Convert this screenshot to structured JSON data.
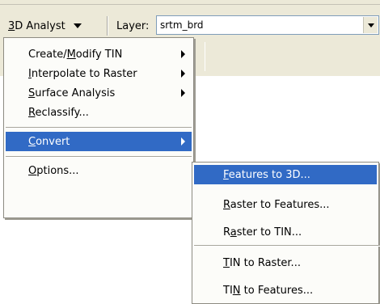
{
  "toolbar": {
    "menu_label_u": "3",
    "menu_label_rest": "D Analyst",
    "layer_label": "Layer:",
    "layer_value": "srtm_brd"
  },
  "analyst_menu": {
    "items": [
      {
        "pre": "Create/",
        "u": "M",
        "post": "odify TIN",
        "has_sub": true
      },
      {
        "pre": "",
        "u": "I",
        "post": "nterpolate to Raster",
        "has_sub": true
      },
      {
        "pre": "",
        "u": "S",
        "post": "urface Analysis",
        "has_sub": true
      },
      {
        "pre": "",
        "u": "R",
        "post": "eclassify...",
        "has_sub": false
      },
      {
        "pre": "",
        "u": "C",
        "post": "onvert",
        "has_sub": true,
        "active": true
      },
      {
        "pre": "",
        "u": "O",
        "post": "ptions...",
        "has_sub": false
      }
    ]
  },
  "convert_submenu": {
    "items": [
      {
        "pre": "",
        "u": "F",
        "post": "eatures to 3D...",
        "active": true
      },
      {
        "pre": "",
        "u": "R",
        "post": "aster to Features..."
      },
      {
        "pre": "R",
        "u": "a",
        "post": "ster to TIN..."
      },
      {
        "pre": "",
        "u": "T",
        "post": "IN to Raster..."
      },
      {
        "pre": "TI",
        "u": "N",
        "post": " to Features..."
      }
    ]
  },
  "colors": {
    "highlight": "#316ac5",
    "toolbar_bg": "#ece9d8",
    "menu_bg": "#fcfcf9"
  },
  "icons": {
    "menu_dropdown": "triangle-down-icon",
    "submenu_arrow": "triangle-right-icon",
    "combo_dropdown": "triangle-down-icon"
  }
}
